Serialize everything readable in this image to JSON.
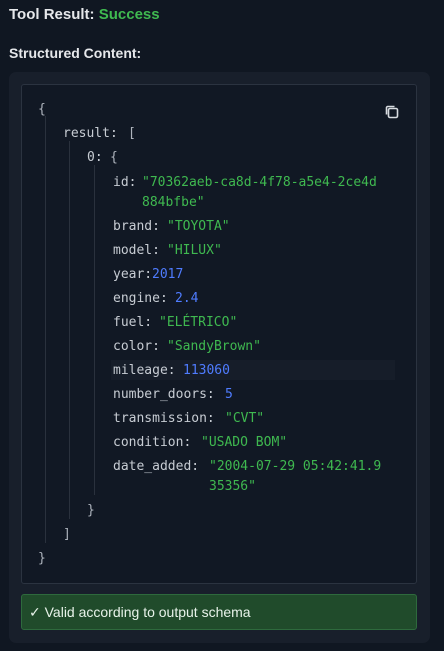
{
  "header": {
    "title_prefix": "Tool Result:",
    "status": "Success",
    "status_color": "#3fb950"
  },
  "section": {
    "label": "Structured Content:"
  },
  "code": {
    "copy_icon": "copy-icon",
    "open_brace": "{",
    "close_brace": "}",
    "result_key": "result:",
    "result_open": "[",
    "result_close": "]",
    "item_index": "0:",
    "item_open": "{",
    "item_close": "}",
    "fields": {
      "id_key": "id:",
      "id_value_line1": "\"70362aeb-ca8d-4f78-a5e4-2ce4d",
      "id_value_line2": "884bfbe\"",
      "brand_key": "brand:",
      "brand_value": "\"TOYOTA\"",
      "model_key": "model:",
      "model_value": "\"HILUX\"",
      "year_key": "year:",
      "year_value": "2017",
      "engine_key": "engine:",
      "engine_value": "2.4",
      "fuel_key": "fuel:",
      "fuel_value": "\"ELÉTRICO\"",
      "color_key": "color:",
      "color_value": "\"SandyBrown\"",
      "mileage_key": "mileage:",
      "mileage_value": "113060",
      "number_doors_key": "number_doors:",
      "number_doors_value": "5",
      "transmission_key": "transmission:",
      "transmission_value": "\"CVT\"",
      "condition_key": "condition:",
      "condition_value": "\"USADO BOM\"",
      "date_added_key": "date_added:",
      "date_added_value_line1": "\"2004-07-29 05:42:41.9",
      "date_added_value_line2": "35356\""
    }
  },
  "validation": {
    "text": "✓ Valid according to output schema"
  },
  "colors": {
    "background": "#101722",
    "panel": "#181f2b",
    "code_background": "#111824",
    "string": "#3fb950",
    "number": "#4f7cff",
    "valid_bar": "#204b2b"
  }
}
